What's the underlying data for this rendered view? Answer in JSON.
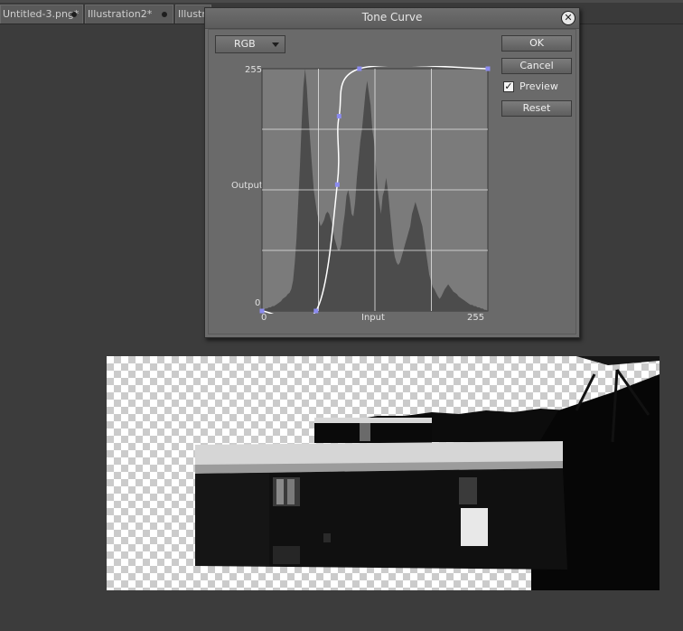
{
  "tabs": [
    {
      "label": "Untitled-3.png*"
    },
    {
      "label": "Illustration2*"
    },
    {
      "label": "Illustra"
    }
  ],
  "dialog": {
    "title": "Tone Curve",
    "channel": "RGB",
    "buttons": {
      "ok": "OK",
      "cancel": "Cancel",
      "reset": "Reset"
    },
    "preview": {
      "label": "Preview",
      "checked": true
    },
    "graph": {
      "y_max": "255",
      "y_label": "Output",
      "y_min": "0",
      "x_min": "0",
      "x_label": "Input",
      "x_max": "255",
      "control_points": [
        [
          0,
          0
        ],
        [
          61,
          0
        ],
        [
          85,
          133
        ],
        [
          87,
          205
        ],
        [
          110,
          255
        ],
        [
          255,
          255
        ]
      ],
      "histogram": [
        0,
        1,
        2,
        2,
        3,
        3,
        4,
        4,
        5,
        6,
        7,
        8,
        10,
        11,
        12,
        14,
        15,
        18,
        25,
        40,
        60,
        90,
        120,
        155,
        185,
        200,
        185,
        160,
        140,
        120,
        100,
        90,
        80,
        75,
        70,
        72,
        75,
        80,
        82,
        80,
        75,
        70,
        60,
        55,
        50,
        50,
        55,
        70,
        80,
        95,
        100,
        92,
        80,
        78,
        90,
        110,
        125,
        140,
        150,
        165,
        180,
        190,
        180,
        170,
        150,
        140,
        120,
        100,
        90,
        80,
        95,
        100,
        110,
        100,
        85,
        70,
        55,
        45,
        40,
        38,
        40,
        45,
        50,
        55,
        60,
        65,
        70,
        80,
        85,
        90,
        85,
        80,
        75,
        70,
        60,
        50,
        40,
        30,
        25,
        20,
        18,
        15,
        12,
        10,
        12,
        15,
        18,
        20,
        22,
        20,
        18,
        16,
        15,
        14,
        12,
        11,
        10,
        9,
        8,
        7,
        6,
        5,
        5,
        4,
        4,
        3,
        3,
        2,
        2,
        1,
        1,
        0
      ],
      "colors": {
        "curve": "#ffffff",
        "point": "#8c8cf0",
        "histogram": "#4c4c4c",
        "plot_bg": "#7b7b7b",
        "grid": "#e6e6e6"
      }
    }
  }
}
